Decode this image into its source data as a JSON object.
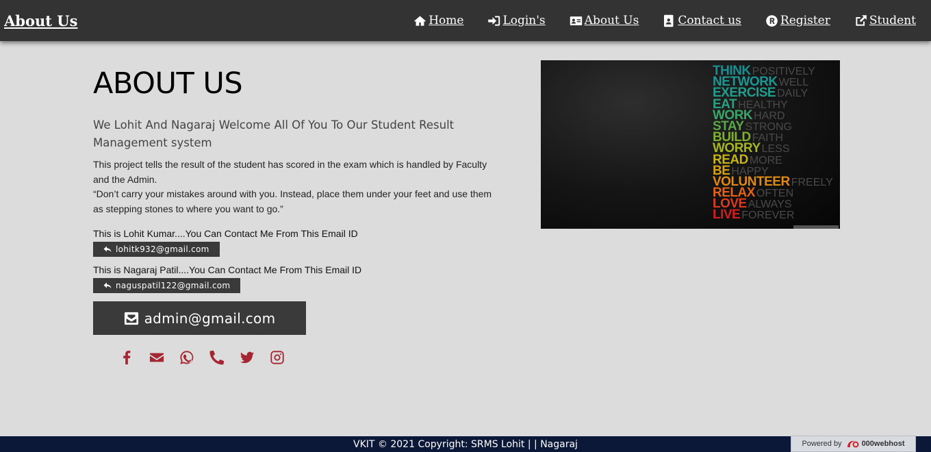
{
  "navbar": {
    "brand": "About Us",
    "items": [
      {
        "label": "Home",
        "icon": "home-icon"
      },
      {
        "label": "Login's",
        "icon": "sign-in-icon"
      },
      {
        "label": "About Us",
        "icon": "id-card-icon"
      },
      {
        "label": "Contact us",
        "icon": "address-book-icon"
      },
      {
        "label": "Register",
        "icon": "registered-icon"
      },
      {
        "label": "Student",
        "icon": "external-link-icon"
      }
    ]
  },
  "main": {
    "title": "ABOUT US",
    "subtitle": "We Lohit And Nagaraj Welcome All Of You To Our Student Result Management system",
    "description_1": "This project tells the result of the student has scored in the exam which is handled by Faculty and the Admin.",
    "description_2": "“Don’t carry your mistakes around with you. Instead, place them under your feet and use them as stepping stones to where you want to go.”",
    "contacts": [
      {
        "text": "This is Lohit Kumar....You Can Contact Me From This Email ID",
        "email": "lohitk932@gmail.com"
      },
      {
        "text": "This is Nagaraj Patil....You Can Contact Me From This Email ID",
        "email": "naguspatil122@gmail.com"
      }
    ],
    "admin_email": "admin@gmail.com",
    "social_icons": [
      "facebook-icon",
      "envelope-icon",
      "whatsapp-icon",
      "phone-icon",
      "twitter-icon",
      "instagram-icon"
    ]
  },
  "poster": {
    "rows": [
      {
        "word": "THINK",
        "tail": "POSITIVELY",
        "color": "#1a8f93"
      },
      {
        "word": "NETWORK",
        "tail": "WELL",
        "color": "#1a9895"
      },
      {
        "word": "EXERCISE",
        "tail": "DAILY",
        "color": "#1e9f8e"
      },
      {
        "word": "EAT",
        "tail": "HEALTHY",
        "color": "#28a27f"
      },
      {
        "word": "WORK",
        "tail": "HARD",
        "color": "#3aa569"
      },
      {
        "word": "STAY",
        "tail": "STRONG",
        "color": "#58a849"
      },
      {
        "word": "BUILD",
        "tail": "FAITH",
        "color": "#7fb12e"
      },
      {
        "word": "WORRY",
        "tail": "LESS",
        "color": "#a6b71e"
      },
      {
        "word": "READ",
        "tail": "MORE",
        "color": "#c6b314"
      },
      {
        "word": "BE",
        "tail": "HAPPY",
        "color": "#d4a213"
      },
      {
        "word": "VOLUNTEER",
        "tail": "FREELY",
        "color": "#df8a14"
      },
      {
        "word": "RELAX",
        "tail": "OFTEN",
        "color": "#e2621a"
      },
      {
        "word": "LOVE",
        "tail": "ALWAYS",
        "color": "#df3a1d"
      },
      {
        "word": "LIVE",
        "tail": "FOREVER",
        "color": "#d41c1d"
      }
    ]
  },
  "footer": {
    "text": "VKIT © 2021 Copyright: SRMS Lohit | | Nagaraj"
  },
  "hosted_badge": {
    "prefix": "Powered by",
    "name": "000webhost"
  },
  "colors": {
    "navbar_bg": "#333333",
    "page_bg": "#dcdcdc",
    "button_bg": "#3a3a3a",
    "social_red": "#a52530",
    "footer_bg": "#0c1838"
  }
}
